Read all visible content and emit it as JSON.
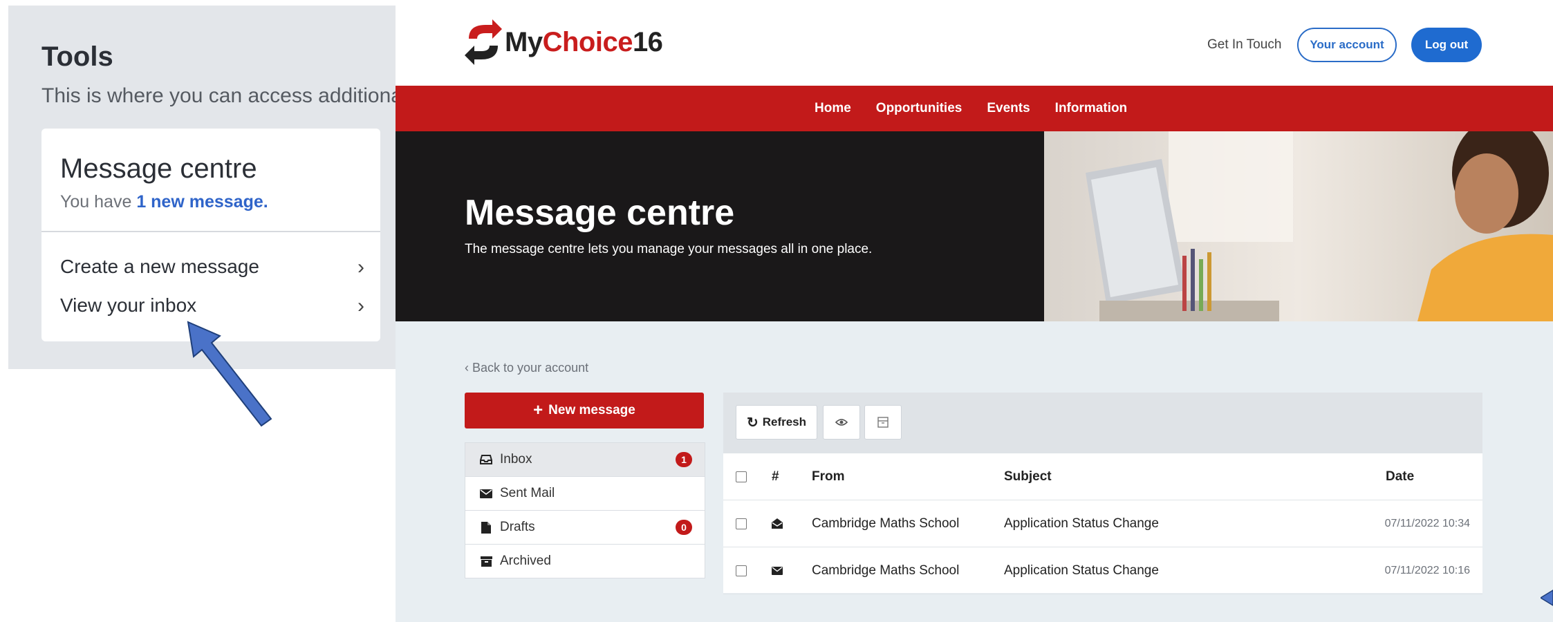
{
  "inset": {
    "title": "Tools",
    "description": "This is where you can access additional",
    "card_title": "Message centre",
    "card_sub_prefix": "You have",
    "card_sub_link": "1 new message.",
    "links": [
      {
        "label": "Create a new message"
      },
      {
        "label": "View your inbox"
      }
    ]
  },
  "header": {
    "logo_my": "My",
    "logo_choice": "Choice",
    "logo_num": "16",
    "get_in_touch": "Get In Touch",
    "your_account": "Your account",
    "log_out": "Log out"
  },
  "nav": [
    "Home",
    "Opportunities",
    "Events",
    "Information"
  ],
  "hero": {
    "title": "Message centre",
    "subtitle": "The message centre lets you manage your messages all in one place."
  },
  "back_link": "Back to your account",
  "new_message": "New message",
  "folders": [
    {
      "label": "Inbox",
      "badge": "1",
      "icon": "inbox-icon"
    },
    {
      "label": "Sent Mail",
      "badge": "",
      "icon": "envelope-icon"
    },
    {
      "label": "Drafts",
      "badge": "0",
      "icon": "file-icon"
    },
    {
      "label": "Archived",
      "badge": "",
      "icon": "archive-icon"
    }
  ],
  "toolbar": {
    "refresh": "Refresh"
  },
  "table": {
    "headers": {
      "hash": "#",
      "from": "From",
      "subject": "Subject",
      "date": "Date"
    },
    "rows": [
      {
        "from": "Cambridge Maths School",
        "subject": "Application Status Change",
        "date": "07/11/2022 10:34",
        "icon": "envelope-open-icon"
      },
      {
        "from": "Cambridge Maths School",
        "subject": "Application Status Change",
        "date": "07/11/2022 10:16",
        "icon": "envelope-icon"
      }
    ]
  },
  "colors": {
    "brand_red": "#c21a1a",
    "accent_blue": "#1f6bd0",
    "arrow_blue": "#4a72c8"
  }
}
